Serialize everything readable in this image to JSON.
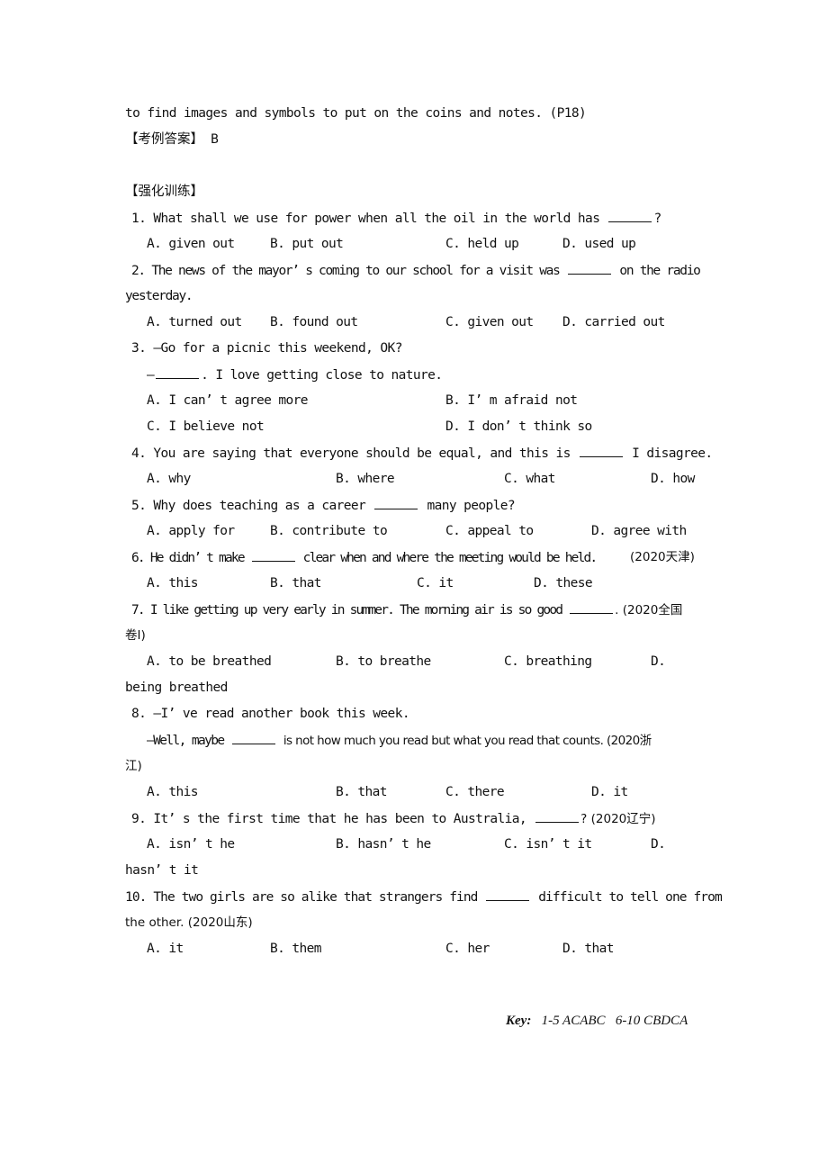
{
  "intro": {
    "continuation": "to find images and symbols to put on the coins and notes. (P18)",
    "answer_label": "【考例答案】",
    "answer_value": "B"
  },
  "section_title": "【强化训练】",
  "questions": [
    {
      "number": "1.",
      "stem_before": "What shall we use for power when all the oil in the world has",
      "stem_after": "?",
      "options": [
        "A. given out",
        "B. put out",
        "C. held up",
        "D. used up"
      ]
    },
    {
      "number": "2.",
      "stem_before": "The news of the mayor’ s coming to our school for a visit was",
      "stem_after": "on the radio",
      "stem_wrap": "yesterday.",
      "options": [
        "A. turned out",
        "B. found out",
        "C. given out",
        "D. carried out"
      ]
    },
    {
      "number": "3.",
      "dialog_1": "—Go for a picnic this weekend, OK?",
      "dialog_2_prefix": "—",
      "dialog_2_after": ". I love getting close to nature.",
      "options": [
        "A. I can’ t agree more",
        "B. I’ m afraid not",
        "C. I believe not",
        "D. I don’ t think so"
      ]
    },
    {
      "number": "4.",
      "stem_before": "You are saying that everyone should be equal, and this is",
      "stem_after": "I disagree.",
      "options": [
        "A. why",
        "B. where",
        "C. what",
        "D. how"
      ]
    },
    {
      "number": "5.",
      "stem_before": "Why does teaching as a career",
      "stem_after": "many people?",
      "options": [
        "A. apply for",
        "B. contribute to",
        "C. appeal to",
        "D. agree with"
      ]
    },
    {
      "number": "6.",
      "stem_before": "He didn’ t make",
      "stem_after": "clear when and where the meeting would be held.",
      "source": "(2020天津)",
      "options": [
        "A. this",
        "B. that",
        "C. it",
        "D. these"
      ]
    },
    {
      "number": "7.",
      "stem_before": "I like getting up very early in summer. The morning air is so good",
      "stem_after": ". (2020全国",
      "stem_wrap": "卷I)",
      "options": [
        "A. to be breathed",
        "B. to breathe",
        "C. breathing",
        "D."
      ],
      "option_wrap": "being breathed"
    },
    {
      "number": "8.",
      "dialog_1": "—I’ ve read another book this week.",
      "dialog_2_before": "—Well, maybe",
      "dialog_2_after": "is not how much you read but what you read that counts. (2020浙",
      "stem_wrap": "江)",
      "options": [
        "A. this",
        "B. that",
        "C. there",
        "D. it"
      ]
    },
    {
      "number": "9.",
      "stem_before": "It’ s the first time that he has been to Australia,",
      "stem_after": "? (2020辽宁)",
      "options": [
        "A. isn’ t he",
        "B. hasn’ t he",
        "C. isn’ t it",
        "D."
      ],
      "option_wrap": "hasn’ t it"
    },
    {
      "number": "10.",
      "stem_before": "The two girls are so alike that strangers find",
      "stem_after": "difficult to tell one from",
      "stem_wrap": "the other. (2020山东)",
      "options": [
        "A. it",
        "B. them",
        "C. her",
        "D. that"
      ]
    }
  ],
  "key": {
    "label": "Key:",
    "part1": "1-5 ACABC",
    "part2": "6-10 CBDCA"
  }
}
